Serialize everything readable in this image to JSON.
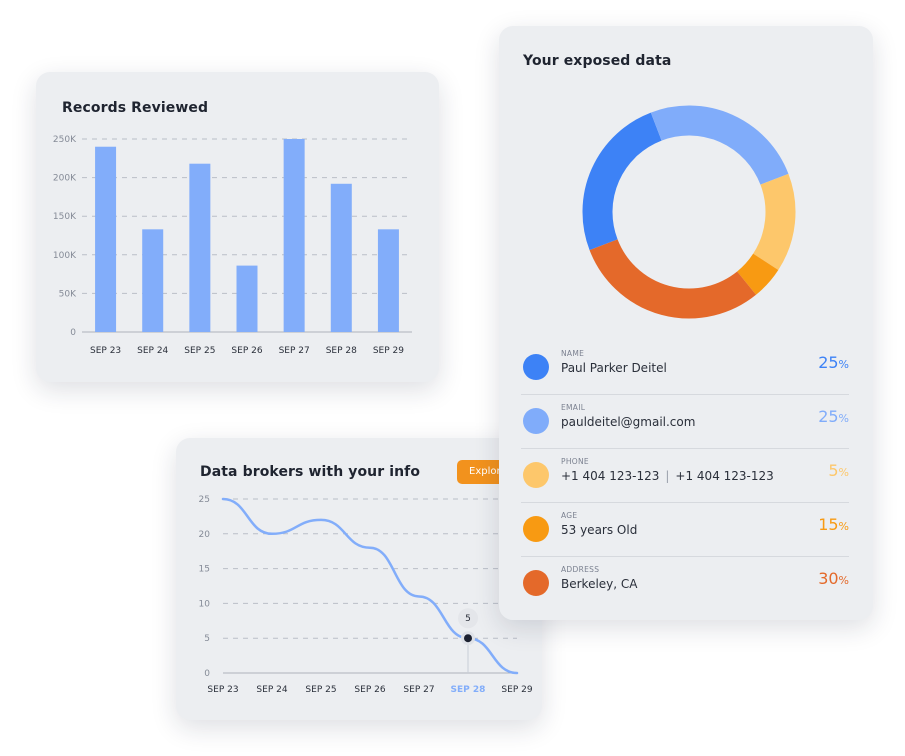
{
  "records": {
    "title": "Records Reviewed"
  },
  "brokers": {
    "title": "Data brokers with your info",
    "explore_label": "Explore",
    "tooltip_value": "5"
  },
  "exposed": {
    "title": "Your exposed data",
    "items": [
      {
        "label": "NAME",
        "value": "Paul Parker Deitel",
        "percent": "25",
        "color": "#3d82f6"
      },
      {
        "label": "EMAIL",
        "value": "pauldeitel@gmail.com",
        "percent": "25",
        "color": "#80acfa"
      },
      {
        "label": "PHONE",
        "value": "+1 404 123-123",
        "value2": "+1 404 123-123",
        "percent": "5",
        "color": "#fdc76b"
      },
      {
        "label": "AGE",
        "value": "53 years Old",
        "percent": "15",
        "color": "#f89a12"
      },
      {
        "label": "ADDRESS",
        "value": "Berkeley, CA",
        "percent": "30",
        "color": "#e4692a"
      }
    ],
    "percent_symbol": "%"
  },
  "chart_data": [
    {
      "type": "bar",
      "title": "Records Reviewed",
      "categories": [
        "SEP 23",
        "SEP 24",
        "SEP 25",
        "SEP 26",
        "SEP 27",
        "SEP 28",
        "SEP 29"
      ],
      "values": [
        240000,
        133000,
        218000,
        86000,
        250000,
        192000,
        133000
      ],
      "ylim": [
        0,
        250000
      ],
      "yticks": [
        0,
        50000,
        100000,
        150000,
        200000,
        250000
      ],
      "ytick_labels": [
        "0",
        "50K",
        "100K",
        "150K",
        "200K",
        "250K"
      ],
      "bar_color": "#82adfa",
      "grid": true
    },
    {
      "type": "line",
      "title": "Data brokers with your info",
      "categories": [
        "SEP 23",
        "SEP 24",
        "SEP 25",
        "SEP 26",
        "SEP 27",
        "SEP 28",
        "SEP 29"
      ],
      "values": [
        25,
        20,
        22,
        18,
        11,
        5,
        0
      ],
      "ylim": [
        0,
        25
      ],
      "yticks": [
        0,
        5,
        10,
        15,
        20,
        25
      ],
      "highlight_index": 5,
      "line_color": "#82adfa",
      "highlight_color": "#82adfa",
      "grid": true
    },
    {
      "type": "pie",
      "title": "Your exposed data",
      "labels": [
        "NAME",
        "EMAIL",
        "PHONE",
        "AGE",
        "ADDRESS"
      ],
      "values": [
        25,
        25,
        15,
        5,
        30
      ],
      "colors": [
        "#3d82f6",
        "#80acfa",
        "#fdc76b",
        "#f89a12",
        "#e4692a"
      ],
      "donut": true
    }
  ]
}
